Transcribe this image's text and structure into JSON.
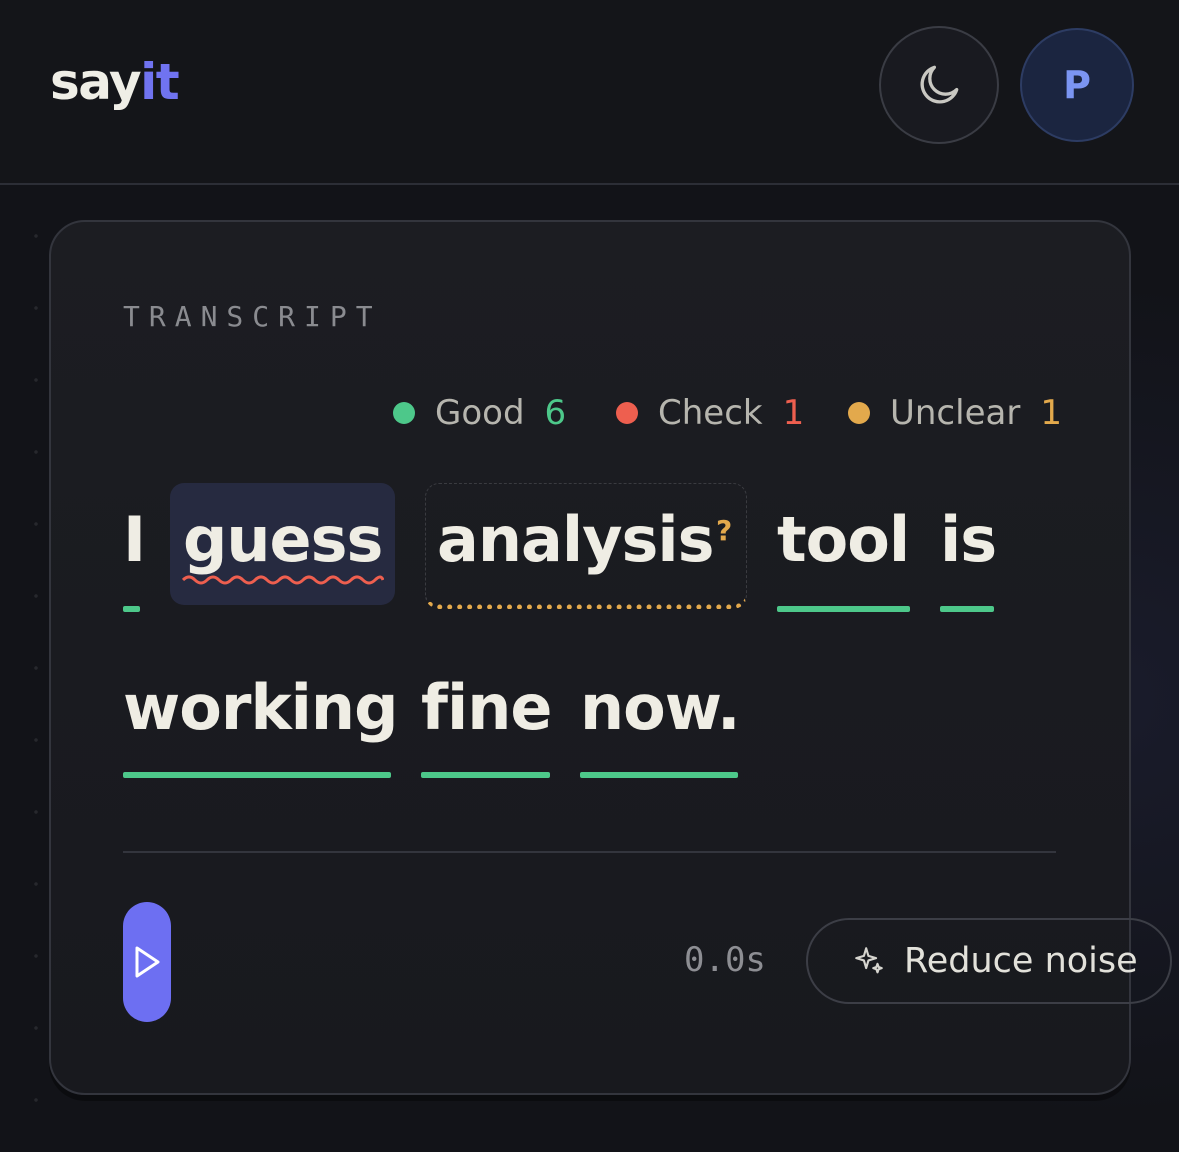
{
  "app": {
    "logo_part1": "say",
    "logo_part2": "it",
    "avatar_initial": "P"
  },
  "transcript": {
    "label": "TRANSCRIPT",
    "legend": [
      {
        "label": "Good",
        "count": "6",
        "color": "#4dc88a"
      },
      {
        "label": "Check",
        "count": "1",
        "color": "#ee5f4f"
      },
      {
        "label": "Unclear",
        "count": "1",
        "color": "#e3a94c"
      }
    ],
    "words": [
      {
        "text": "I",
        "status": "good"
      },
      {
        "text": "guess",
        "status": "check"
      },
      {
        "text": "analysis",
        "status": "unclear"
      },
      {
        "text": "tool",
        "status": "good"
      },
      {
        "text": "is",
        "status": "good"
      },
      {
        "text": "working",
        "status": "good"
      },
      {
        "text": "fine",
        "status": "good"
      },
      {
        "text": "now.",
        "status": "good"
      }
    ],
    "unclear_marker": "?"
  },
  "player": {
    "time": "0.0s",
    "reduce_noise_label": "Reduce noise"
  },
  "colors": {
    "accent": "#6d6ff2",
    "good": "#4dc88a",
    "check": "#ee5f4f",
    "unclear": "#e3a94c"
  },
  "icons": {
    "theme": "moon-icon",
    "play": "play-icon",
    "noise": "sparkle-icon"
  }
}
